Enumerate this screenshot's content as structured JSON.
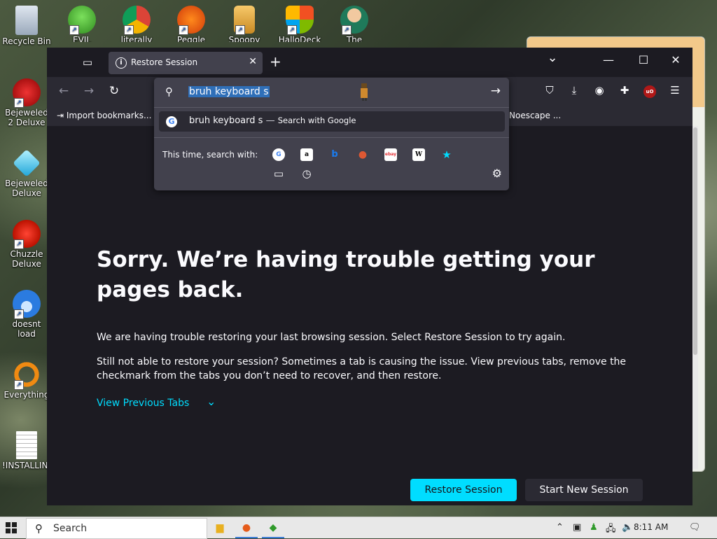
{
  "desktop": {
    "icons": [
      {
        "label": "Recycle Bin"
      },
      {
        "label": "EVIL GREEN"
      },
      {
        "label": "literally"
      },
      {
        "label": "Peggle Nights"
      },
      {
        "label": "Spoopy"
      },
      {
        "label": "HalloDeck"
      },
      {
        "label": "The Legend"
      },
      {
        "label": "Bejeweled 2 Deluxe"
      },
      {
        "label": "Bejeweled Deluxe"
      },
      {
        "label": "Chuzzle Deluxe"
      },
      {
        "label": "doesnt load"
      },
      {
        "label": "Everything"
      },
      {
        "label": "!INSTALLIN..."
      }
    ]
  },
  "browser": {
    "tab": {
      "title": "Restore Session",
      "close": "✕"
    },
    "new_tab": "+",
    "window_controls": {
      "list": "⌄",
      "minimize": "—",
      "maximize": "☐",
      "close": "✕"
    },
    "nav": {
      "back": "←",
      "forward": "→",
      "reload": "↻"
    },
    "bookmarks": {
      "import": "Import bookmarks...",
      "noescape": "Noescape ..."
    },
    "urlbar": {
      "value": "bruh keyboard s",
      "go": "→",
      "suggestion_query": "bruh keyboard s",
      "suggestion_sep": "—",
      "suggestion_action": "Search with Google",
      "oneoff_label": "This time, search with:",
      "engines": [
        {
          "name": "Google",
          "glyph": "G",
          "color": "#4285f4",
          "bg": "#ffffff"
        },
        {
          "name": "Amazon",
          "glyph": "a",
          "color": "#111111",
          "bg": "#ffffff"
        },
        {
          "name": "Bing",
          "glyph": "b",
          "color": "#1a7cf0",
          "bg": "transparent"
        },
        {
          "name": "DuckDuckGo",
          "glyph": "●",
          "color": "#de5833",
          "bg": "transparent"
        },
        {
          "name": "eBay",
          "glyph": "ebay",
          "color": "#e53238",
          "bg": "#ffffff"
        },
        {
          "name": "Wikipedia",
          "glyph": "W",
          "color": "#000000",
          "bg": "#ffffff"
        },
        {
          "name": "Bookmarks",
          "glyph": "★",
          "color": "#00ddff",
          "bg": "transparent"
        },
        {
          "name": "Tabs",
          "glyph": "▭",
          "color": "#fbfbfe",
          "bg": "transparent"
        },
        {
          "name": "History",
          "glyph": "◷",
          "color": "#fbfbfe",
          "bg": "transparent"
        }
      ]
    },
    "page": {
      "title": "Sorry. We’re having trouble getting your pages back.",
      "p1": "We are having trouble restoring your last browsing session. Select Restore Session to try again.",
      "p2": "Still not able to restore your session? Sometimes a tab is causing the issue. View previous tabs, remove the checkmark from the tabs you don’t need to recover, and then restore.",
      "view_previous": "View Previous Tabs",
      "restore_button": "Restore Session",
      "new_session_button": "Start New Session"
    }
  },
  "taskbar": {
    "search_placeholder": "Search",
    "time": "8:11 AM"
  },
  "colors": {
    "accent": "#00ddff",
    "page_bg": "#1c1b22",
    "toolbar_bg": "#2b2a33",
    "panel_bg": "#42414d"
  }
}
